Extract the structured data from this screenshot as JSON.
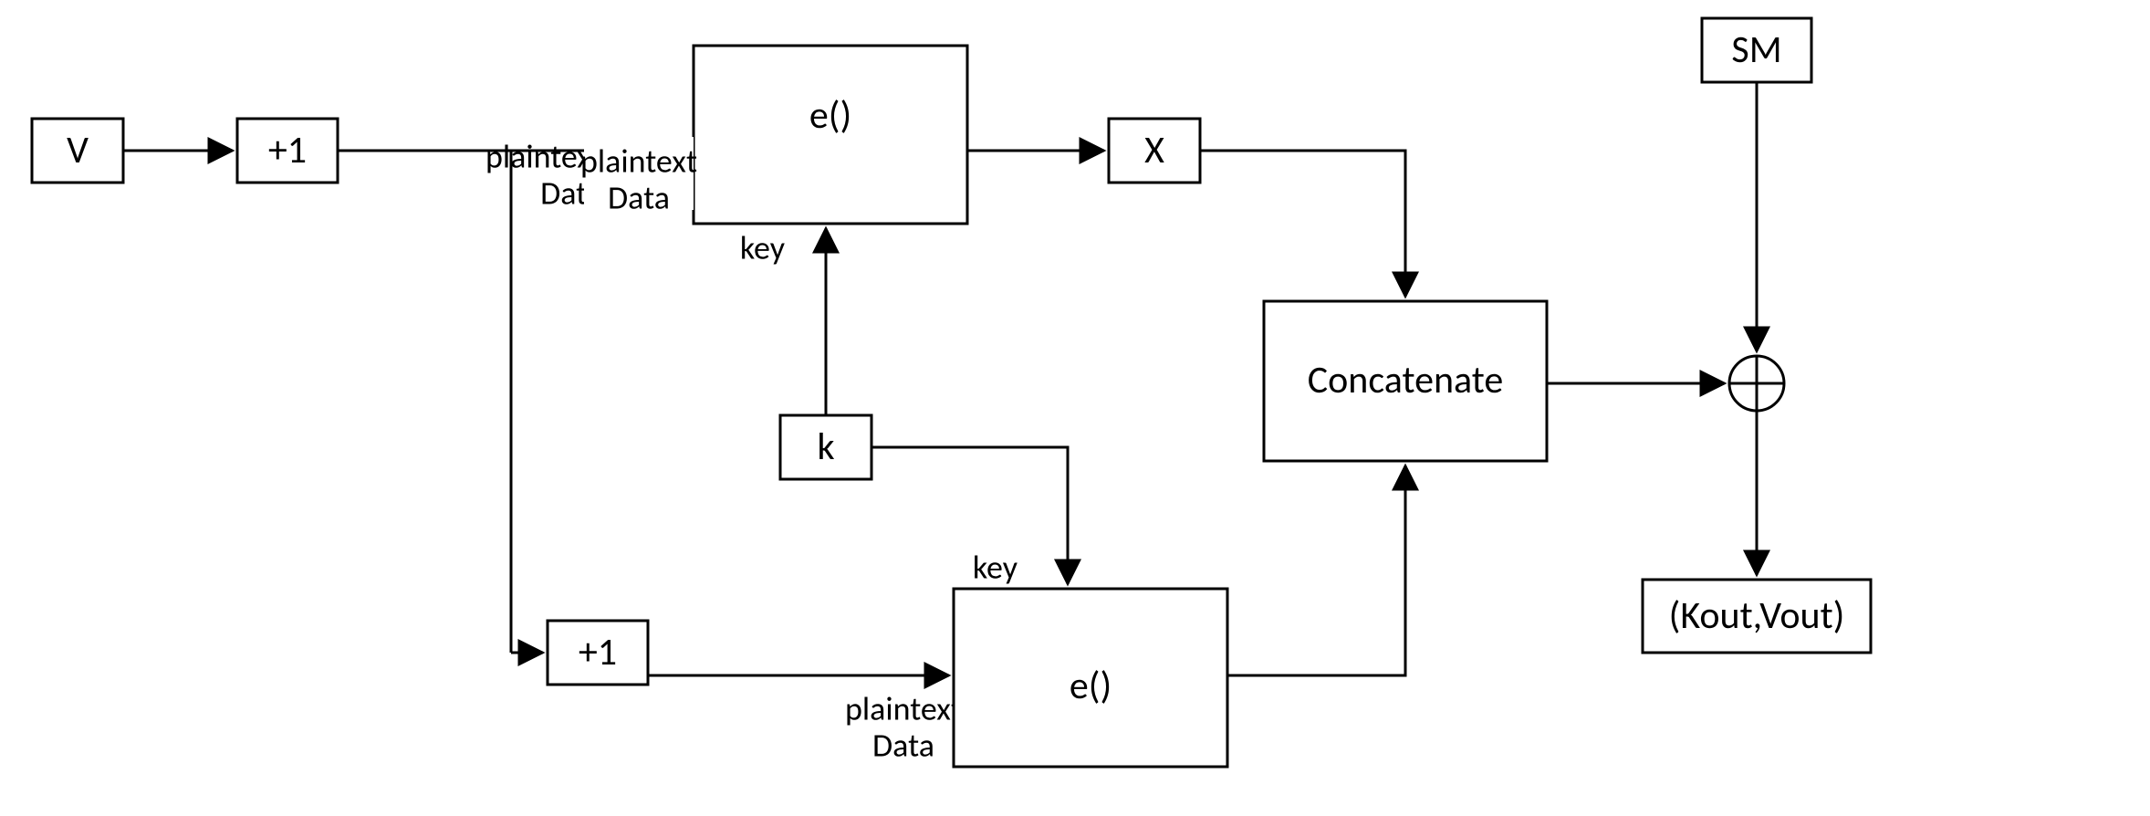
{
  "blocks": {
    "v": "V",
    "inc1": "+1",
    "inc2": "+1",
    "e1": "e()",
    "e2": "e()",
    "x": "X",
    "k": "k",
    "concat": "Concatenate",
    "sm": "SM",
    "out": "(Kout,Vout)"
  },
  "labels": {
    "plaintext": "plaintext",
    "data": "Data",
    "key": "key"
  }
}
